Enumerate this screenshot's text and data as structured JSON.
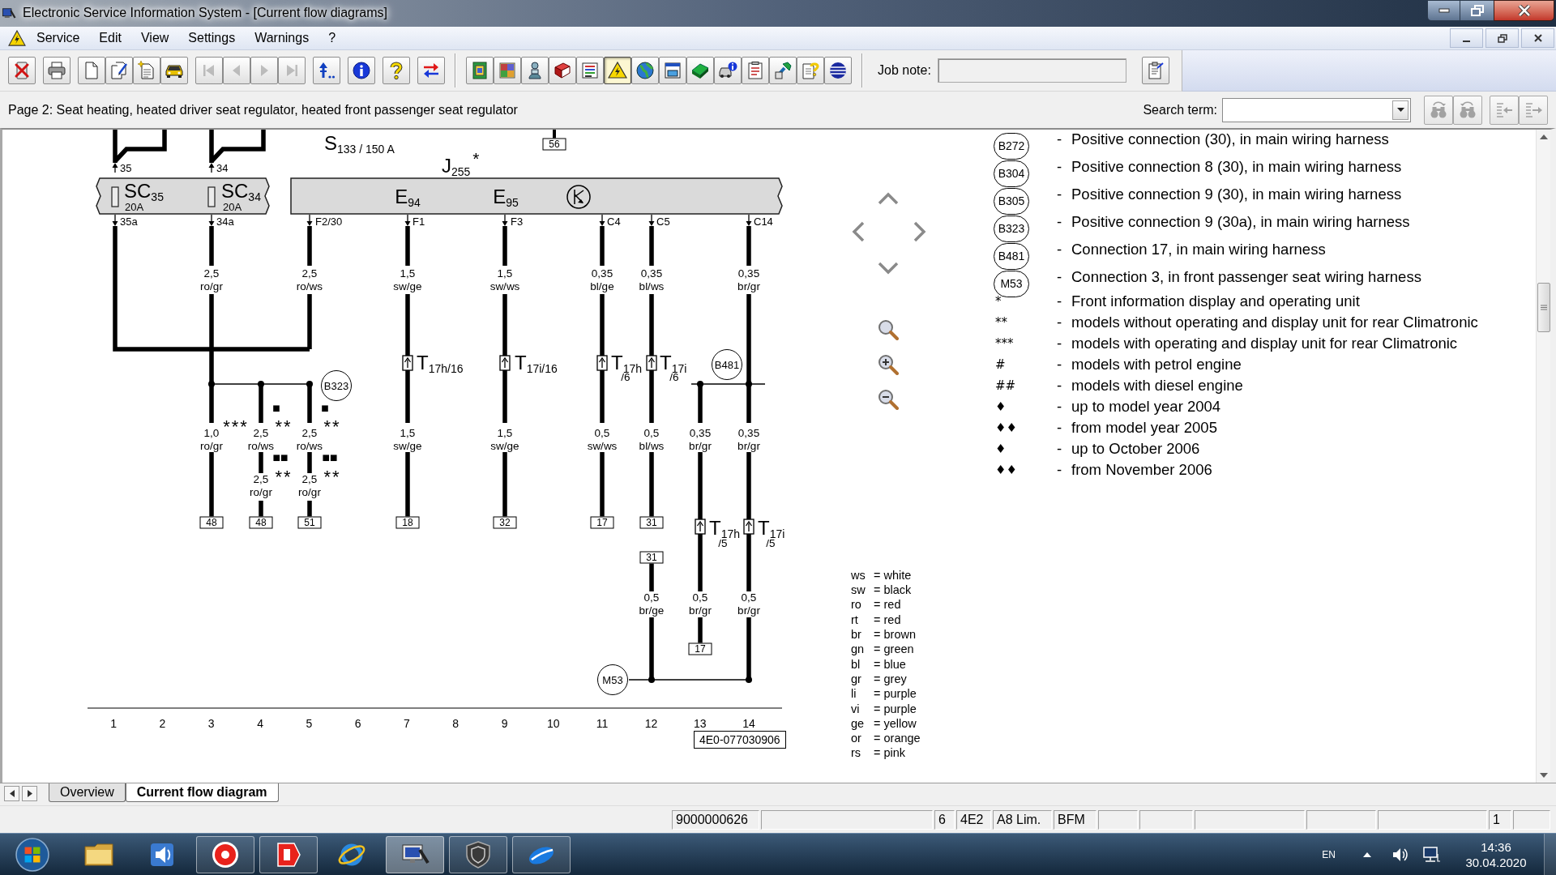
{
  "window": {
    "title": "Electronic Service Information System - [Current flow diagrams]"
  },
  "menu": {
    "items": [
      "Service",
      "Edit",
      "View",
      "Settings",
      "Warnings",
      "?"
    ]
  },
  "toolbar": {
    "sections": [
      {
        "groups": [
          [
            {
              "kind": "exit",
              "disabled": false,
              "on": false
            }
          ],
          [
            {
              "kind": "print",
              "disabled": false,
              "on": false
            }
          ],
          [
            {
              "kind": "document",
              "disabled": false,
              "on": false
            },
            {
              "kind": "document-check",
              "disabled": false,
              "on": false
            },
            {
              "kind": "document-new",
              "disabled": false,
              "on": false
            },
            {
              "kind": "vehicle",
              "disabled": false,
              "on": false
            }
          ],
          [
            {
              "kind": "first",
              "disabled": true,
              "on": false
            },
            {
              "kind": "previous",
              "disabled": true,
              "on": false
            },
            {
              "kind": "next",
              "disabled": true,
              "on": false
            },
            {
              "kind": "last",
              "disabled": true,
              "on": false
            }
          ],
          [
            {
              "kind": "jump",
              "disabled": false,
              "on": false
            }
          ],
          [
            {
              "kind": "info",
              "disabled": false,
              "on": false
            }
          ],
          [
            {
              "kind": "help",
              "disabled": false,
              "on": false
            }
          ],
          [
            {
              "kind": "swap",
              "disabled": false,
              "on": false
            }
          ]
        ]
      },
      {
        "groups": [
          [
            {
              "kind": "sheet",
              "disabled": false,
              "on": false
            },
            {
              "kind": "grid",
              "disabled": false,
              "on": false
            },
            {
              "kind": "technician",
              "disabled": false,
              "on": false
            },
            {
              "kind": "manual",
              "disabled": false,
              "on": false
            },
            {
              "kind": "list",
              "disabled": false,
              "on": false
            },
            {
              "kind": "warnings",
              "disabled": false,
              "on": true
            },
            {
              "kind": "globe",
              "disabled": false,
              "on": false
            },
            {
              "kind": "window",
              "disabled": false,
              "on": false
            },
            {
              "kind": "block",
              "disabled": false,
              "on": false
            },
            {
              "kind": "vehicle-info",
              "disabled": false,
              "on": false
            },
            {
              "kind": "checklist",
              "disabled": false,
              "on": false
            },
            {
              "kind": "tool",
              "disabled": false,
              "on": false
            },
            {
              "kind": "document-help",
              "disabled": false,
              "on": false
            },
            {
              "kind": "ball",
              "disabled": false,
              "on": false
            }
          ]
        ]
      }
    ],
    "job_note": {
      "label": "Job note:"
    }
  },
  "page_bar": {
    "title": "Page 2: Seat heating, heated driver seat regulator, heated front passenger seat regulator",
    "search": {
      "label": "Search term:"
    },
    "buttons": [
      {
        "kind": "find-next",
        "disabled": true
      },
      {
        "kind": "find-previous",
        "disabled": true
      },
      {
        "kind": "outdent",
        "disabled": true
      },
      {
        "kind": "indent",
        "disabled": true
      }
    ]
  },
  "diagram": {
    "fuse_carrier": "S$_{133 / 150 A}$",
    "control_unit": {
      "label": "J$_{255}$",
      "mark": "*",
      "parts": [
        "E$_{94}$",
        "E$_{95}$"
      ],
      "pins": [
        "F2/30",
        "F1",
        "F3",
        "C4",
        "C5",
        "C14"
      ]
    },
    "fuses": [
      {
        "label": "SC$_{35}$",
        "rating": "20A",
        "pin_in": "35",
        "pin_out": "35a"
      },
      {
        "label": "SC$_{34}$",
        "rating": "20A",
        "pin_in": "34",
        "pin_out": "34a"
      }
    ],
    "wire_labels": [
      {
        "gauge": "2,5",
        "code": "ro/gr"
      },
      {
        "gauge": "2,5",
        "code": "ro/ws"
      },
      {
        "gauge": "1,5",
        "code": "sw/ge"
      },
      {
        "gauge": "1,5",
        "code": "sw/ws"
      },
      {
        "gauge": "0,35",
        "code": "bl/ge"
      },
      {
        "gauge": "0,35",
        "code": "bl/ws"
      },
      {
        "gauge": "0,35",
        "code": "br/gr"
      },
      {
        "gauge": "1,0",
        "code": "ro/gr"
      },
      {
        "gauge": "2,5",
        "code": "ro/ws"
      },
      {
        "gauge": "2,5",
        "code": "ro/ws"
      },
      {
        "gauge": "1,5",
        "code": "sw/ge"
      },
      {
        "gauge": "1,5",
        "code": "sw/ge"
      },
      {
        "gauge": "0,5",
        "code": "sw/ws"
      },
      {
        "gauge": "0,5",
        "code": "bl/ws"
      },
      {
        "gauge": "0,35",
        "code": "br/gr"
      },
      {
        "gauge": "0,35",
        "code": "br/gr"
      },
      {
        "gauge": "2,5",
        "code": "ro/gr"
      },
      {
        "gauge": "2,5",
        "code": "ro/gr"
      },
      {
        "gauge": "0,5",
        "code": "br/ge"
      },
      {
        "gauge": "0,5",
        "code": "br/gr"
      },
      {
        "gauge": "0,5",
        "code": "br/gr"
      }
    ],
    "connectors": [
      {
        "label": "T$_{17h/16}$"
      },
      {
        "label": "T$_{17i/16}$"
      },
      {
        "label": "T$_{17h}$",
        "pin": "/6"
      },
      {
        "label": "T$_{17i}$",
        "pin": "/6"
      },
      {
        "label": "T$_{17h}$",
        "pin": "/5"
      },
      {
        "label": "T$_{17i}$",
        "pin": "/5"
      }
    ],
    "junctions": [
      "B323",
      "B481",
      "M53"
    ],
    "option_marks": [
      "■",
      "■",
      "***",
      "**",
      "**",
      "■■",
      "■■",
      "**",
      "**"
    ],
    "terminals": [
      "56",
      "48",
      "48",
      "51",
      "18",
      "32",
      "17",
      "31",
      "31",
      "17"
    ],
    "columns": [
      "1",
      "2",
      "3",
      "4",
      "5",
      "6",
      "7",
      "8",
      "9",
      "10",
      "11",
      "12",
      "13",
      "14"
    ],
    "part_number": "4E0-077030906"
  },
  "legend": {
    "codes": [
      {
        "code": "B272",
        "dash": "-",
        "text": "Positive connection (30), in main wiring harness"
      },
      {
        "code": "B304",
        "dash": "-",
        "text": "Positive connection 8 (30), in main wiring harness"
      },
      {
        "code": "B305",
        "dash": "-",
        "text": "Positive connection 9 (30), in main wiring harness"
      },
      {
        "code": "B323",
        "dash": "-",
        "text": "Positive connection 9 (30a), in main wiring harness"
      },
      {
        "code": "B481",
        "dash": "-",
        "text": "Connection 17, in main wiring harness"
      },
      {
        "code": "M53",
        "dash": "-",
        "text": "Connection 3, in front passenger seat wiring harness"
      }
    ],
    "symbols": [
      {
        "symbol": "*",
        "dash": "-",
        "text": "Front information display and operating unit"
      },
      {
        "symbol": "**",
        "dash": "-",
        "text": "models without operating and display unit for rear Climatronic"
      },
      {
        "symbol": "***",
        "dash": "-",
        "text": "models with operating and display unit for rear Climatronic"
      },
      {
        "symbol": "#",
        "dash": "-",
        "text": "models with petrol engine"
      },
      {
        "symbol": "##",
        "dash": "-",
        "text": "models with diesel engine"
      },
      {
        "symbol": "♦",
        "dash": "-",
        "text": "up to model year 2004"
      },
      {
        "symbol": "♦♦",
        "dash": "-",
        "text": "from model year 2005"
      },
      {
        "symbol": "♦",
        "dash": "-",
        "text": "up to October 2006"
      },
      {
        "symbol": "♦♦",
        "dash": "-",
        "text": "from November 2006"
      }
    ],
    "wire_codes": [
      {
        "code": "ws",
        "meaning": "= white"
      },
      {
        "code": "sw",
        "meaning": "= black"
      },
      {
        "code": "ro",
        "meaning": "= red"
      },
      {
        "code": "rt",
        "meaning": "= red"
      },
      {
        "code": "br",
        "meaning": "= brown"
      },
      {
        "code": "gn",
        "meaning": "= green"
      },
      {
        "code": "bl",
        "meaning": "= blue"
      },
      {
        "code": "gr",
        "meaning": "= grey"
      },
      {
        "code": "li",
        "meaning": "= purple"
      },
      {
        "code": "vi",
        "meaning": "= purple"
      },
      {
        "code": "ge",
        "meaning": "= yellow"
      },
      {
        "code": "or",
        "meaning": "= orange"
      },
      {
        "code": "rs",
        "meaning": "= pink"
      }
    ]
  },
  "tabs": [
    {
      "label": "Overview",
      "selected": false
    },
    {
      "label": "Current flow diagram",
      "selected": true
    }
  ],
  "status_bar": {
    "cells": [
      "9000000626",
      "6",
      "4E2",
      "A8 Lim.",
      "BFM",
      "1"
    ]
  },
  "taskbar": {
    "apps": [
      {
        "kind": "folder",
        "running": false,
        "active": false
      },
      {
        "kind": "media",
        "running": false,
        "active": false
      },
      {
        "kind": "disc",
        "running": true,
        "active": false
      },
      {
        "kind": "tag",
        "running": true,
        "active": false
      },
      {
        "kind": "orbit",
        "running": false,
        "active": false
      },
      {
        "kind": "tool",
        "running": true,
        "active": true
      },
      {
        "kind": "shield",
        "running": true,
        "active": false
      },
      {
        "kind": "swoosh",
        "running": true,
        "active": false
      }
    ],
    "tray": {
      "language": "EN",
      "time": "14:36",
      "date": "30.04.2020"
    }
  }
}
